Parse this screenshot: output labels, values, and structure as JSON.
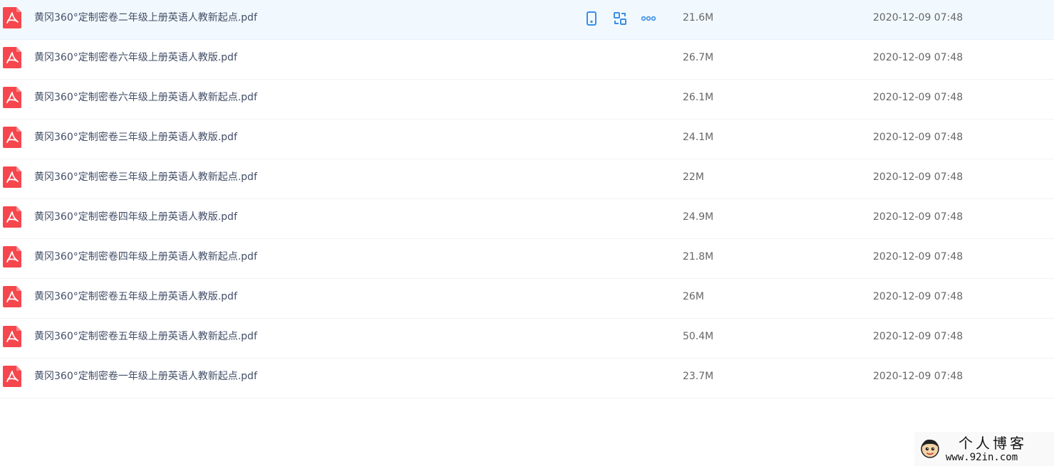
{
  "files": [
    {
      "name": "黄冈360°定制密卷二年级上册英语人教新起点.pdf",
      "size": "21.6M",
      "date": "2020-12-09 07:48"
    },
    {
      "name": "黄冈360°定制密卷六年级上册英语人教版.pdf",
      "size": "26.7M",
      "date": "2020-12-09 07:48"
    },
    {
      "name": "黄冈360°定制密卷六年级上册英语人教新起点.pdf",
      "size": "26.1M",
      "date": "2020-12-09 07:48"
    },
    {
      "name": "黄冈360°定制密卷三年级上册英语人教版.pdf",
      "size": "24.1M",
      "date": "2020-12-09 07:48"
    },
    {
      "name": "黄冈360°定制密卷三年级上册英语人教新起点.pdf",
      "size": "22M",
      "date": "2020-12-09 07:48"
    },
    {
      "name": "黄冈360°定制密卷四年级上册英语人教版.pdf",
      "size": "24.9M",
      "date": "2020-12-09 07:48"
    },
    {
      "name": "黄冈360°定制密卷四年级上册英语人教新起点.pdf",
      "size": "21.8M",
      "date": "2020-12-09 07:48"
    },
    {
      "name": "黄冈360°定制密卷五年级上册英语人教版.pdf",
      "size": "26M",
      "date": "2020-12-09 07:48"
    },
    {
      "name": "黄冈360°定制密卷五年级上册英语人教新起点.pdf",
      "size": "50.4M",
      "date": "2020-12-09 07:48"
    },
    {
      "name": "黄冈360°定制密卷一年级上册英语人教新起点.pdf",
      "size": "23.7M",
      "date": "2020-12-09 07:48"
    }
  ],
  "hovered_row_index": 0,
  "row_actions": [
    {
      "icon": "phone-icon"
    },
    {
      "icon": "share-link-icon"
    },
    {
      "icon": "more-icon"
    }
  ],
  "watermark": {
    "title": "个人博客",
    "url": "www.92in.com"
  },
  "colors": {
    "pdf_red": "#f5474d",
    "action_blue": "#3a8ee6",
    "hover_bg": "#f2f9fe",
    "text": "#424e67",
    "meta_text": "#666666"
  }
}
